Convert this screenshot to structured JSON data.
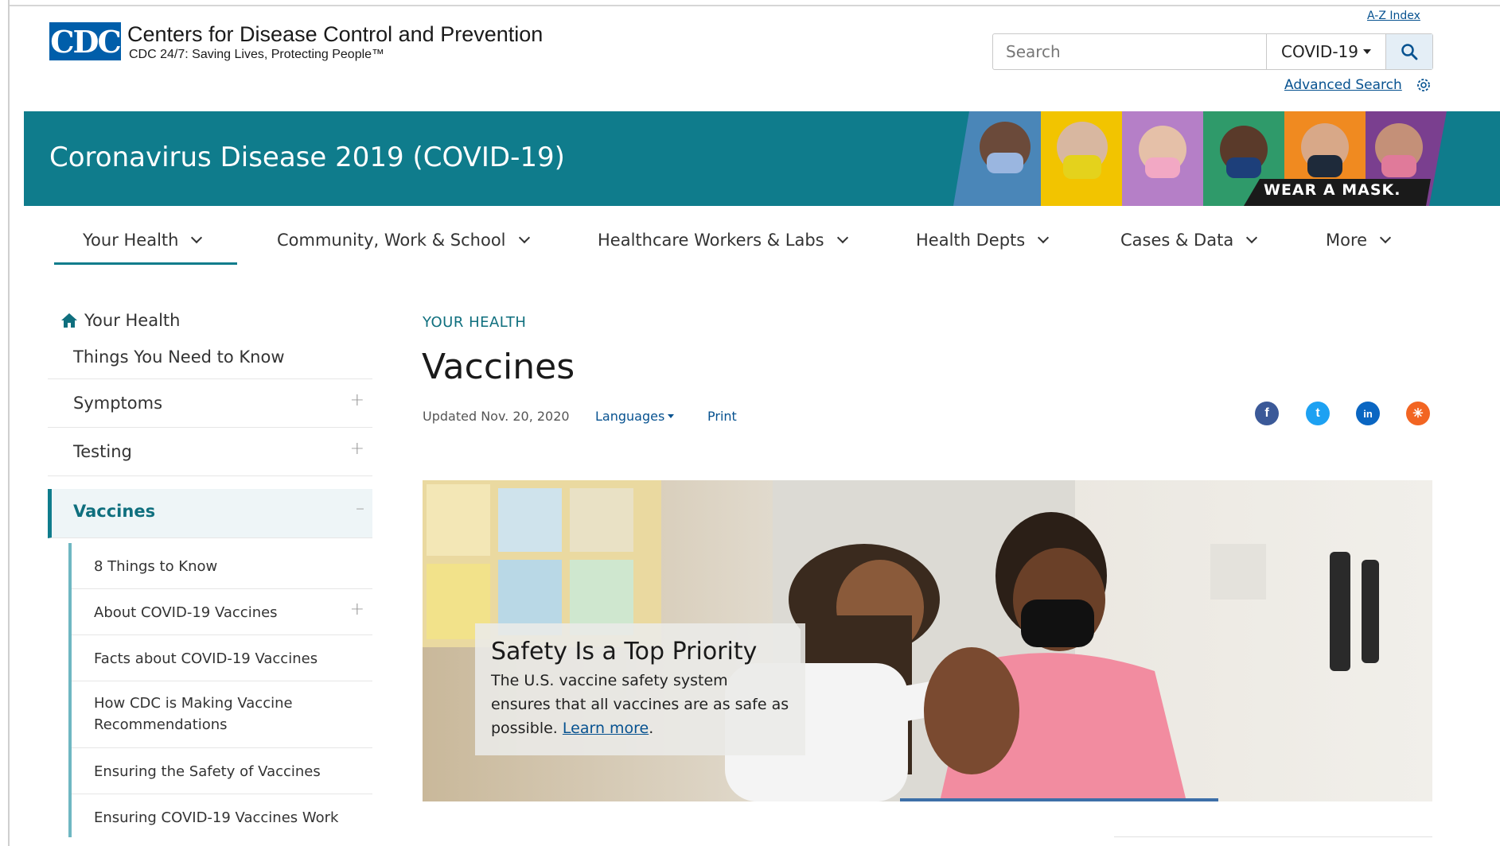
{
  "header": {
    "logo_text": "CDC",
    "org_title": "Centers for Disease Control and Prevention",
    "tagline": "CDC 24/7: Saving Lives, Protecting People™",
    "az_index": "A-Z Index",
    "search": {
      "placeholder": "Search",
      "scope": "COVID-19",
      "advanced_label": "Advanced Search"
    }
  },
  "banner": {
    "title": "Coronavirus Disease 2019 (COVID-19)",
    "slogan": "WEAR A MASK."
  },
  "nav": {
    "items": [
      {
        "label": "Your Health"
      },
      {
        "label": "Community, Work & School"
      },
      {
        "label": "Healthcare Workers & Labs"
      },
      {
        "label": "Health Depts"
      },
      {
        "label": "Cases & Data"
      },
      {
        "label": "More"
      }
    ]
  },
  "sidebar": {
    "home": "Your Health",
    "items": [
      {
        "label": "Things You Need to Know"
      },
      {
        "label": "Symptoms",
        "expand": "+"
      },
      {
        "label": "Testing",
        "expand": "+"
      },
      {
        "label": "Vaccines",
        "expand": "–"
      }
    ],
    "sub_items": [
      {
        "label": "8 Things to Know"
      },
      {
        "label": "About COVID-19 Vaccines",
        "expand": "+"
      },
      {
        "label": "Facts about COVID-19 Vaccines"
      },
      {
        "label": "How CDC is Making Vaccine Recommendations"
      },
      {
        "label": "Ensuring the Safety of Vaccines"
      },
      {
        "label": "Ensuring COVID-19 Vaccines Work"
      }
    ]
  },
  "main": {
    "breadcrumb": "YOUR HEALTH",
    "title": "Vaccines",
    "updated": "Updated Nov. 20, 2020",
    "languages": "Languages",
    "print": "Print",
    "social": [
      {
        "name": "facebook-icon",
        "glyph": "f",
        "color": "#3b5998"
      },
      {
        "name": "twitter-icon",
        "glyph": "t",
        "color": "#1da1f2"
      },
      {
        "name": "linkedin-icon",
        "glyph": "in",
        "color": "#0a66c2"
      },
      {
        "name": "syndicate-icon",
        "glyph": "✳",
        "color": "#f26522"
      }
    ],
    "hero": {
      "callout_title": "Safety Is a Top Priority",
      "callout_text": "The U.S. vaccine safety system ensures that all vaccines are as safe as possible.",
      "link_text": "Learn more",
      "link_suffix": "."
    }
  },
  "colors": {
    "teal": "#0f7c8c",
    "cdc_blue": "#005eaa",
    "link": "#075290"
  }
}
